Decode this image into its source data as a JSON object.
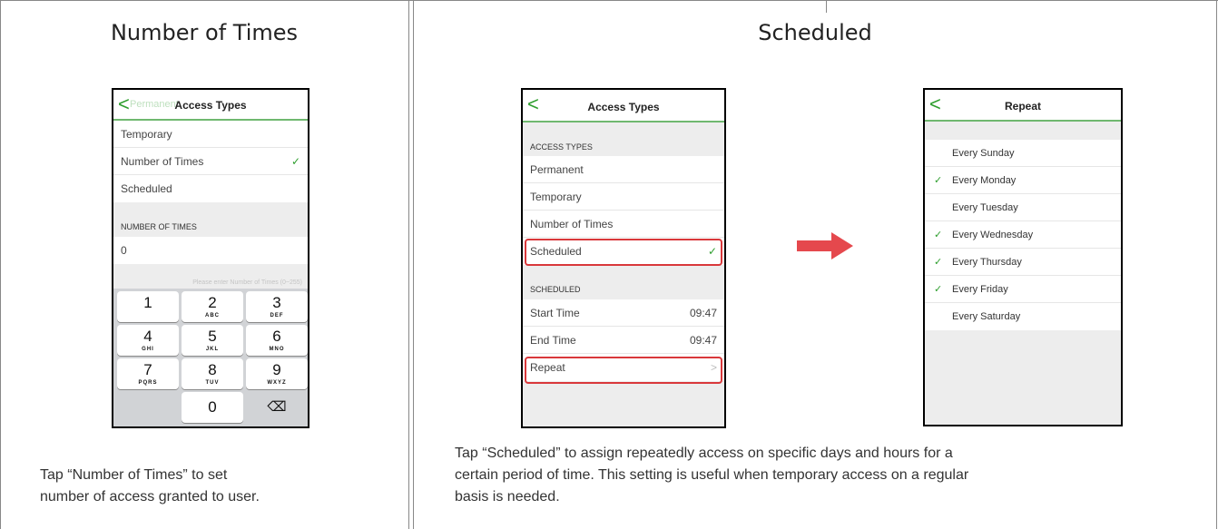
{
  "left": {
    "title": "Number of Times",
    "phone": {
      "nav": {
        "back": "<",
        "back_text": "Permanent",
        "title": "Access Types"
      },
      "items": [
        {
          "label": "Temporary",
          "check": ""
        },
        {
          "label": "Number of Times",
          "check": "✓"
        },
        {
          "label": "Scheduled",
          "check": ""
        }
      ],
      "section": "NUMBER OF TIMES",
      "value": "0",
      "hint": "Please enter Number of Times (0~255)",
      "keys": [
        {
          "num": "1",
          "letters": ""
        },
        {
          "num": "2",
          "letters": "ABC"
        },
        {
          "num": "3",
          "letters": "DEF"
        },
        {
          "num": "4",
          "letters": "GHI"
        },
        {
          "num": "5",
          "letters": "JKL"
        },
        {
          "num": "6",
          "letters": "MNO"
        },
        {
          "num": "7",
          "letters": "PQRS"
        },
        {
          "num": "8",
          "letters": "TUV"
        },
        {
          "num": "9",
          "letters": "WXYZ"
        },
        {
          "num": "0",
          "letters": ""
        },
        {
          "num": "⌫",
          "letters": ""
        }
      ]
    },
    "caption_line1": "Tap “Number of Times” to set",
    "caption_line2": "number of access granted to user."
  },
  "right": {
    "title": "Scheduled",
    "phone1": {
      "nav": {
        "back": "<",
        "title": "Access Types"
      },
      "section1": "ACCESS TYPES",
      "items": [
        {
          "label": "Permanent"
        },
        {
          "label": "Temporary"
        },
        {
          "label": "Number of Times"
        },
        {
          "label": "Scheduled",
          "check": "✓"
        }
      ],
      "section2": "SCHEDULED",
      "start_label": "Start Time",
      "start_value": "09:47",
      "end_label": "End Time",
      "end_value": "09:47",
      "repeat_label": "Repeat",
      "repeat_chev": ">"
    },
    "phone2": {
      "nav": {
        "back": "<",
        "title": "Repeat"
      },
      "days": [
        {
          "label": "Every Sunday",
          "check": ""
        },
        {
          "label": "Every Monday",
          "check": "✓"
        },
        {
          "label": "Every Tuesday",
          "check": ""
        },
        {
          "label": "Every Wednesday",
          "check": "✓"
        },
        {
          "label": "Every Thursday",
          "check": "✓"
        },
        {
          "label": "Every Friday",
          "check": "✓"
        },
        {
          "label": "Every Saturday",
          "check": ""
        }
      ]
    },
    "caption_line1": "Tap “Scheduled” to assign repeatedly access on specific days and hours for a",
    "caption_line2": "certain period of time. This setting is useful when temporary access on a regular",
    "caption_line3": "basis is needed."
  },
  "colors": {
    "accent_green": "#2e9e2e",
    "highlight_red": "#d9383b",
    "arrow_red": "#e5484d"
  }
}
